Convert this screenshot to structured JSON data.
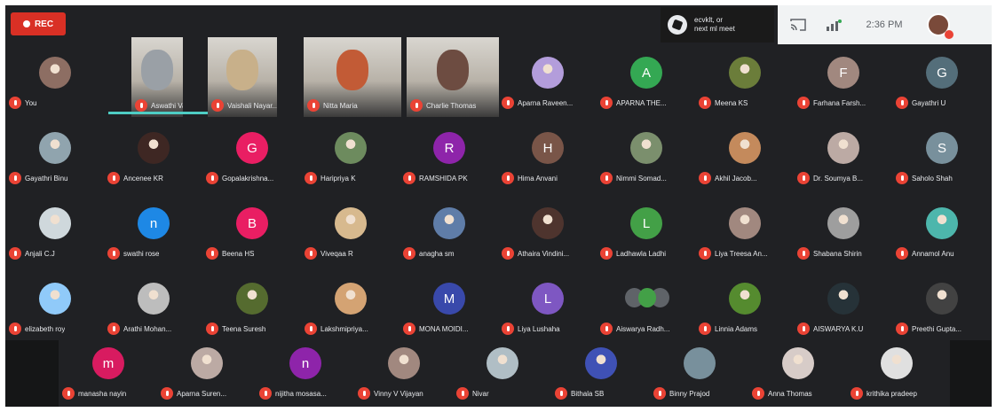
{
  "toolbar": {
    "rec_label": "REC"
  },
  "meet_badge": {
    "line1": "ecvklt, or",
    "line2": "next ml meet"
  },
  "system_tray": {
    "clock": "2:36 PM"
  },
  "video_tiles": [
    {
      "name": "Aswathi Vazha...",
      "tone": "#9aa0a6"
    },
    {
      "name": "Vaishali Nayar...",
      "tone": "#c8b08a"
    },
    {
      "name": "Nitta Maria",
      "tone": "#c25b36"
    },
    {
      "name": "Charlie Thomas",
      "tone": "#6d4c41"
    }
  ],
  "tiles": [
    {
      "name": "You",
      "kind": "photo",
      "bg": "#8d6e63"
    },
    {
      "name": "Aparna Raveen...",
      "kind": "photo",
      "bg": "#b39ddb"
    },
    {
      "name": "APARNA THE...",
      "kind": "initial",
      "initial": "A",
      "bg": "#34a853"
    },
    {
      "name": "Meena KS",
      "kind": "photo",
      "bg": "#6b7d3a"
    },
    {
      "name": "Farhana Farsh...",
      "kind": "initial",
      "initial": "F",
      "bg": "#a1887f"
    },
    {
      "name": "Gayathri U",
      "kind": "initial",
      "initial": "G",
      "bg": "#546e7a"
    },
    {
      "name": "Gayathri Binu",
      "kind": "photo",
      "bg": "#90a4ae"
    },
    {
      "name": "Ancenee KR",
      "kind": "photo",
      "bg": "#3e2723"
    },
    {
      "name": "Gopalakrishna...",
      "kind": "initial",
      "initial": "G",
      "bg": "#e91e63"
    },
    {
      "name": "Haripriya K",
      "kind": "photo",
      "bg": "#6d8b5e"
    },
    {
      "name": "RAMSHIDA PK",
      "kind": "initial",
      "initial": "R",
      "bg": "#8e24aa"
    },
    {
      "name": "Hima Anvani",
      "kind": "initial",
      "initial": "H",
      "bg": "#795548"
    },
    {
      "name": "Nimmi Somad...",
      "kind": "photo",
      "bg": "#7b8f6d"
    },
    {
      "name": "Akhil Jacob...",
      "kind": "photo",
      "bg": "#c48a5c"
    },
    {
      "name": "Dr. Soumya B...",
      "kind": "photo",
      "bg": "#bcaaa4"
    },
    {
      "name": "Saholo Shah",
      "kind": "initial",
      "initial": "S",
      "bg": "#78909c"
    },
    {
      "name": "Anjali C.J",
      "kind": "photo",
      "bg": "#cfd8dc"
    },
    {
      "name": "swathi rose",
      "kind": "initial",
      "initial": "n",
      "bg": "#1e88e5"
    },
    {
      "name": "Beena HS",
      "kind": "initial",
      "initial": "B",
      "bg": "#e91e63"
    },
    {
      "name": "Viveqaa R",
      "kind": "photo",
      "bg": "#d7b98e"
    },
    {
      "name": "anagha sm",
      "kind": "photo",
      "bg": "#5f7da8"
    },
    {
      "name": "Athaira Vindini...",
      "kind": "photo",
      "bg": "#4e342e"
    },
    {
      "name": "Ladhawla Ladhi",
      "kind": "initial",
      "initial": "L",
      "bg": "#43a047"
    },
    {
      "name": "Liya Treesa An...",
      "kind": "photo",
      "bg": "#a1887f"
    },
    {
      "name": "Shabana Shirin",
      "kind": "photo",
      "bg": "#9e9e9e"
    },
    {
      "name": "Annamol Anu",
      "kind": "photo",
      "bg": "#4db6ac"
    },
    {
      "name": "elizabeth roy",
      "kind": "photo",
      "bg": "#90caf9"
    },
    {
      "name": "Arathi Mohan...",
      "kind": "photo",
      "bg": "#bdbdbd"
    },
    {
      "name": "Teena Suresh",
      "kind": "photo",
      "bg": "#556b2f"
    },
    {
      "name": "Lakshmipriya...",
      "kind": "photo",
      "bg": "#d4a373"
    },
    {
      "name": "MONA MOIDI...",
      "kind": "initial",
      "initial": "M",
      "bg": "#3949ab"
    },
    {
      "name": "Liya Lushaha",
      "kind": "initial",
      "initial": "L",
      "bg": "#7e57c2"
    },
    {
      "name": "Aiswarya Radh...",
      "kind": "cluster",
      "bg": "#43a047"
    },
    {
      "name": "Linnia Adams",
      "kind": "photo",
      "bg": "#558b2f"
    },
    {
      "name": "AISWARYA K.U",
      "kind": "photo",
      "bg": "#263238"
    },
    {
      "name": "Preethi Gupta...",
      "kind": "photo",
      "bg": "#424242"
    },
    {
      "name": "manasha nayin",
      "kind": "initial",
      "initial": "m",
      "bg": "#d81b60"
    },
    {
      "name": "Aparna Suren...",
      "kind": "photo",
      "bg": "#bcaaa4"
    },
    {
      "name": "nijitha mosasa...",
      "kind": "initial",
      "initial": "n",
      "bg": "#8e24aa"
    },
    {
      "name": "Vinny V Vijayan",
      "kind": "photo",
      "bg": "#a1887f"
    },
    {
      "name": "Nivar",
      "kind": "photo",
      "bg": "#b0bec5"
    },
    {
      "name": "Bithala SB",
      "kind": "photo",
      "bg": "#3f51b5"
    },
    {
      "name": "Binny Prajod",
      "kind": "initial",
      "initial": "",
      "bg": "#78909c"
    },
    {
      "name": "Anna Thomas",
      "kind": "photo",
      "bg": "#d7ccc8"
    },
    {
      "name": "krithika pradeep",
      "kind": "photo",
      "bg": "#e0e0e0"
    }
  ]
}
